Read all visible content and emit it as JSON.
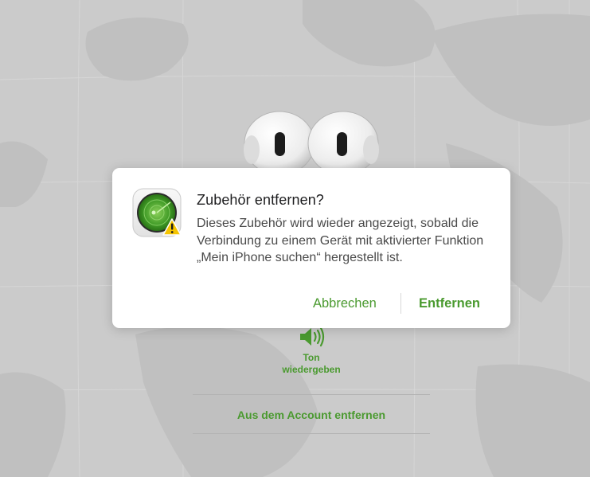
{
  "dialog": {
    "title": "Zubehör entfernen?",
    "message": "Dieses Zubehör wird wieder angezeigt, sobald die Verbindung zu einem Gerät mit aktivierter Funktion „Mein iPhone suchen“ hergestellt ist.",
    "cancel_label": "Abbrechen",
    "confirm_label": "Entfernen",
    "icon": "find-my-radar-warning-icon"
  },
  "actions": {
    "play_sound_line1": "Ton",
    "play_sound_line2": "wiedergeben",
    "remove_from_account": "Aus dem Account entfernen"
  },
  "colors": {
    "accent": "#4a9a2f",
    "map_background": "#cbcbcb",
    "dialog_background": "#ffffff",
    "warning": "#f5c400"
  }
}
